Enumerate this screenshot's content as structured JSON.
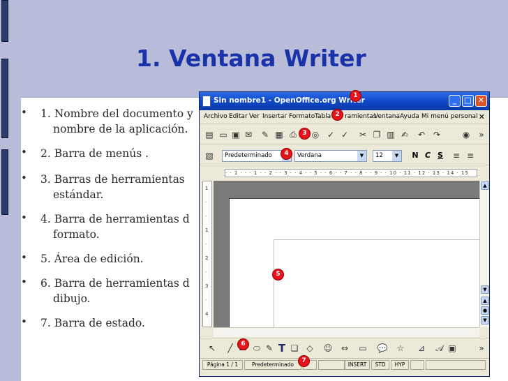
{
  "slide": {
    "title": "1. Ventana Writer",
    "bullets": [
      {
        "line1": "1. Nombre del documento y",
        "line2": "nombre de la aplicación."
      },
      {
        "line1": "2. Barra de menús .",
        "line2": ""
      },
      {
        "line1": "3. Barras de herramientas",
        "line2": "estándar."
      },
      {
        "line1": "4. Barra de herramientas d",
        "line2": "formato."
      },
      {
        "line1": "5. Área de edición.",
        "line2": ""
      },
      {
        "line1": "6. Barra de herramientas d",
        "line2": "dibujo."
      },
      {
        "line1": "7. Barra de estado.",
        "line2": ""
      }
    ],
    "bullet_symbol": "•"
  },
  "window": {
    "title": "Sin nombre1 - OpenOffice.org Writer",
    "buttons": {
      "minimize": "_",
      "maximize": "□",
      "close": "✕"
    },
    "menus": [
      "Archivo",
      "Editar",
      "Ver",
      "Insertar",
      "Formato",
      "Tabla",
      "ramientas",
      "Ventana",
      "Ayuda",
      "Mi menú personal"
    ],
    "menu_close": "✕",
    "format": {
      "style": "Predeterminado",
      "font": "Verdana",
      "size": "12",
      "bold": "N",
      "italic": "C",
      "underline": "S"
    },
    "ruler": "· · 1 · · · 1 · · 2 · · 3 · · 4 · · 5 · · 6 · · 7 · · 8 · · 9 · · 10 · 11 · 12 · 13 · 14 · 15",
    "vruler_marks": [
      "1",
      "·",
      "·",
      "1",
      "·",
      "2",
      "·",
      "3",
      "·",
      "4"
    ],
    "status": {
      "page": "Página 1 / 1",
      "style": "Predeterminado",
      "insert": "INSERT",
      "std": "STD",
      "hyp": "HYP"
    }
  },
  "markers": [
    "1",
    "2",
    "3",
    "4",
    "5",
    "6",
    "7"
  ],
  "colors": {
    "slide_bg": "#b8bcd8",
    "title": "#1a32a8",
    "titlebar": "#1048c8",
    "marker": "#e8121a"
  }
}
